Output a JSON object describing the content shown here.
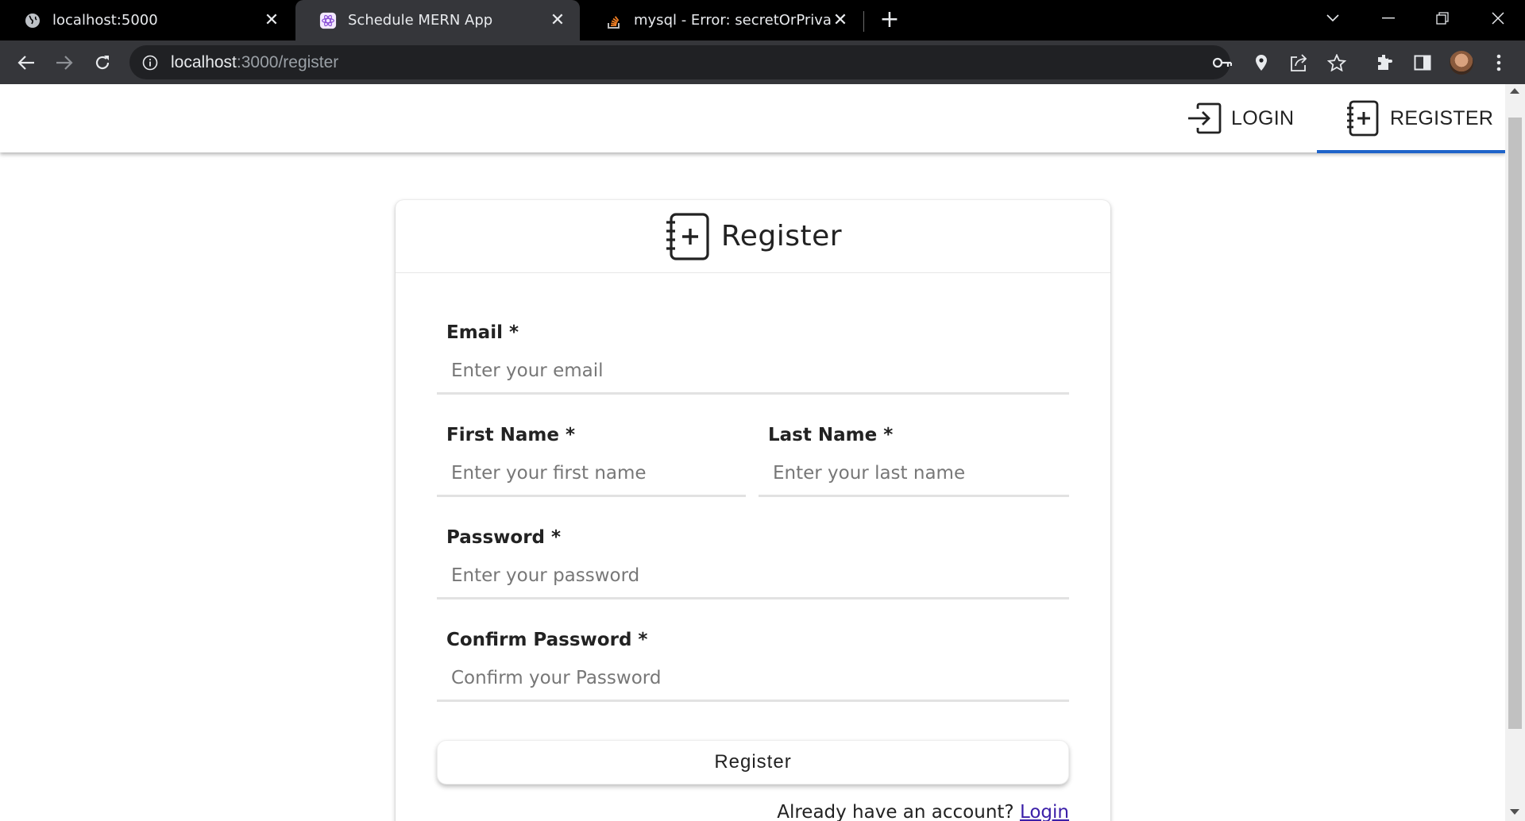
{
  "browser": {
    "tabs": [
      {
        "title": "localhost:5000",
        "icon": "globe-icon",
        "active": false
      },
      {
        "title": "Schedule MERN App",
        "icon": "react-icon",
        "active": true
      },
      {
        "title": "mysql - Error: secretOrPrivateKey",
        "icon": "stackoverflow-icon",
        "active": false
      }
    ],
    "url_host": "localhost",
    "url_path": ":3000/register"
  },
  "navbar": {
    "login_label": "LOGIN",
    "register_label": "REGISTER",
    "active": "register",
    "accent_color": "#1e63c9"
  },
  "card": {
    "title": "Register",
    "fields": {
      "email": {
        "label": "Email *",
        "placeholder": "Enter your email",
        "value": ""
      },
      "first_name": {
        "label": "First Name *",
        "placeholder": "Enter your first name",
        "value": ""
      },
      "last_name": {
        "label": "Last Name *",
        "placeholder": "Enter your last name",
        "value": ""
      },
      "password": {
        "label": "Password *",
        "placeholder": "Enter your password",
        "value": ""
      },
      "confirm_password": {
        "label": "Confirm Password *",
        "placeholder": "Confirm your Password",
        "value": ""
      }
    },
    "submit_label": "Register",
    "footer_text": "Already have an account?",
    "footer_link": "Login"
  }
}
